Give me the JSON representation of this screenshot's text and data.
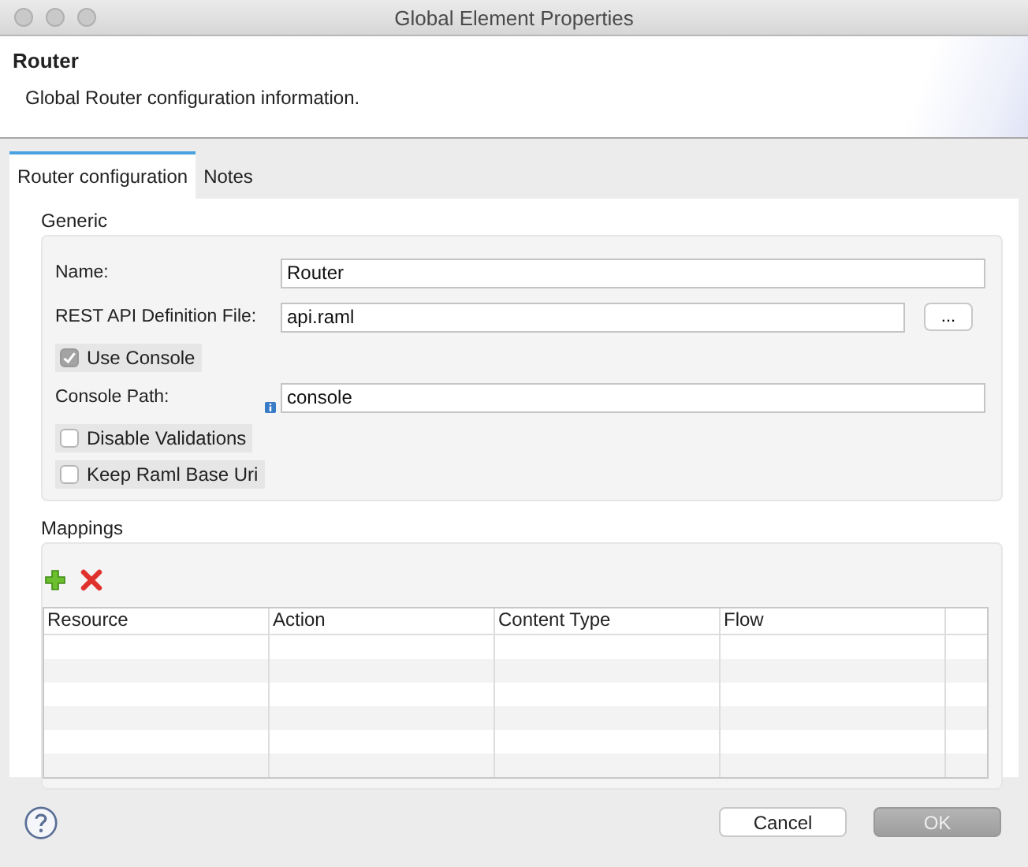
{
  "window": {
    "title": "Global Element Properties"
  },
  "header": {
    "title": "Router",
    "description": "Global Router configuration information."
  },
  "tabs": [
    {
      "label": "Router configuration",
      "selected": true
    },
    {
      "label": "Notes",
      "selected": false
    }
  ],
  "generic": {
    "title": "Generic",
    "rows": [
      {
        "kind": "text",
        "label": "Name:",
        "value": "Router",
        "info": false
      },
      {
        "kind": "file",
        "label": "REST API Definition File:",
        "value": "api.raml",
        "button": "...",
        "info": false
      },
      {
        "kind": "checkbox",
        "label": "Use Console",
        "checked": true
      },
      {
        "kind": "text",
        "label": "Console Path:",
        "value": "console",
        "info": true
      },
      {
        "kind": "checkbox",
        "label": "Disable Validations",
        "checked": false
      },
      {
        "kind": "checkbox",
        "label": "Keep Raml Base Uri",
        "checked": false
      }
    ]
  },
  "mappings": {
    "title": "Mappings",
    "columns": [
      "Resource",
      "Action",
      "Content Type",
      "Flow"
    ]
  },
  "buttons": [
    {
      "label": "Cancel",
      "disabled": false
    },
    {
      "label": "OK",
      "disabled": true
    }
  ]
}
